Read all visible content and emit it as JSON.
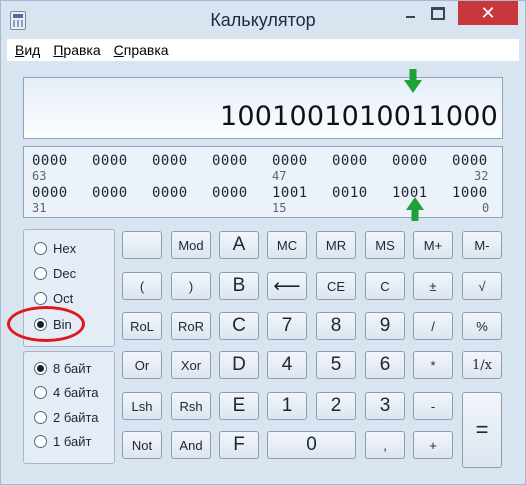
{
  "window": {
    "title": "Калькулятор"
  },
  "menu": {
    "items": [
      {
        "u": "В",
        "rest": "ид"
      },
      {
        "u": "П",
        "rest": "равка"
      },
      {
        "u": "С",
        "rest": "правка"
      }
    ]
  },
  "display": {
    "value": "1001001010011000"
  },
  "bits": {
    "row1": [
      "0000",
      "0000",
      "0000",
      "0000",
      "0000",
      "0000",
      "0000",
      "0000"
    ],
    "row1_positions": [
      "63",
      "47",
      "32"
    ],
    "row2": [
      "0000",
      "0000",
      "0000",
      "0000",
      "1001",
      "0010",
      "1001",
      "1000"
    ],
    "row2_positions": [
      "31",
      "15",
      "0"
    ]
  },
  "base_options": {
    "selected": "Bin",
    "items": [
      "Hex",
      "Dec",
      "Oct",
      "Bin"
    ]
  },
  "word_options": {
    "selected": "8 байт",
    "items": [
      "8 байт",
      "4 байта",
      "2 байта",
      "1 байт"
    ]
  },
  "keys": {
    "row1": [
      "",
      "Mod",
      "A",
      "MC",
      "MR",
      "MS",
      "M+",
      "M-"
    ],
    "row2": [
      "(",
      ")",
      "B",
      "⟵",
      "CE",
      "C",
      "±",
      "√"
    ],
    "row3": [
      "RoL",
      "RoR",
      "C",
      "7",
      "8",
      "9",
      "/",
      "%"
    ],
    "row4": [
      "Or",
      "Xor",
      "D",
      "4",
      "5",
      "6",
      "*",
      "1/x"
    ],
    "row5": [
      "Lsh",
      "Rsh",
      "E",
      "1",
      "2",
      "3",
      "-",
      "="
    ],
    "row6": [
      "Not",
      "And",
      "F",
      "0",
      ",",
      "+"
    ]
  },
  "colors": {
    "arrow": "#1ea237",
    "highlight": "#e0171b",
    "close": "#c7373b"
  }
}
